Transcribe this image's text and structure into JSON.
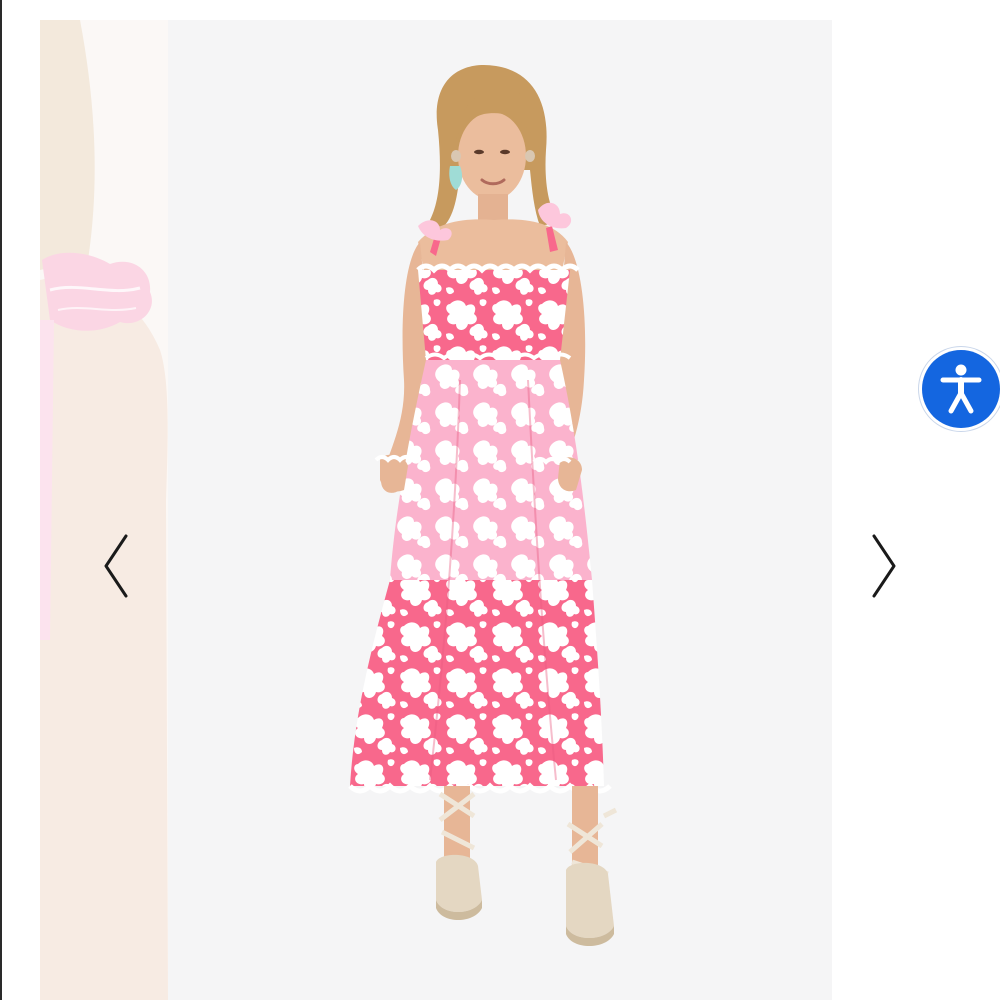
{
  "carousel": {
    "main_image": {
      "alt": "",
      "colors": {
        "background": "#f5f5f6",
        "dress_pink": "#f8688c",
        "dress_light_pink": "#fdc7dc",
        "print_white": "#ffffff",
        "skin": "#e9b898",
        "hair": "#c79a5e",
        "espadrille": "#e4d7c2"
      }
    },
    "previous_image": {
      "alt": ""
    },
    "controls": {
      "prev_icon": "chevron-left-icon",
      "next_icon": "chevron-right-icon"
    }
  },
  "accessibility": {
    "icon": "accessibility-person-icon",
    "color": "#1466e0"
  }
}
